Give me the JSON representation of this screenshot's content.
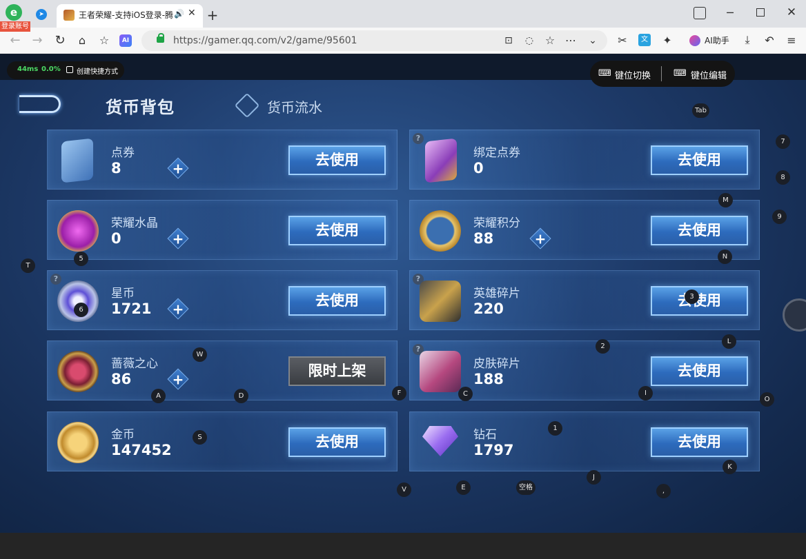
{
  "browser": {
    "login_badge": "登录账号",
    "tab": {
      "title": "王者荣耀-支持iOS登录-腾"
    },
    "url": "https://gamer.qq.com/v2/game/95601",
    "ai_helper": "AI助手",
    "ai_badge": "AI"
  },
  "overlay": {
    "latency": "44ms",
    "loss": "0.0%",
    "shortcut": "创建快捷方式",
    "key_switch": "键位切换",
    "key_edit": "键位编辑"
  },
  "header": {
    "title": "货币背包",
    "flow_tab": "货币流水"
  },
  "currencies": [
    {
      "name": "点券",
      "value": "8",
      "button": "去使用"
    },
    {
      "name": "绑定点券",
      "value": "0",
      "button": "去使用"
    },
    {
      "name": "荣耀水晶",
      "value": "0",
      "button": "去使用"
    },
    {
      "name": "荣耀积分",
      "value": "88",
      "button": "去使用"
    },
    {
      "name": "星币",
      "value": "1721",
      "button": "去使用"
    },
    {
      "name": "英雄碎片",
      "value": "220",
      "button": "去使用"
    },
    {
      "name": "蔷薇之心",
      "value": "86",
      "button": "限时上架"
    },
    {
      "name": "皮肤碎片",
      "value": "188",
      "button": "去使用"
    },
    {
      "name": "金币",
      "value": "147452",
      "button": "去使用"
    },
    {
      "name": "钻石",
      "value": "1797",
      "button": "去使用"
    }
  ],
  "plus_symbol": "+",
  "question_symbol": "?",
  "keys": [
    "Tab",
    "7",
    "8",
    "M",
    "9",
    "T",
    "5",
    "N",
    "6",
    "3",
    "2",
    "L",
    "W",
    "A",
    "D",
    "F",
    "C",
    "I",
    "O",
    "S",
    "1",
    "K",
    "J",
    "V",
    "E",
    "空格",
    ","
  ]
}
